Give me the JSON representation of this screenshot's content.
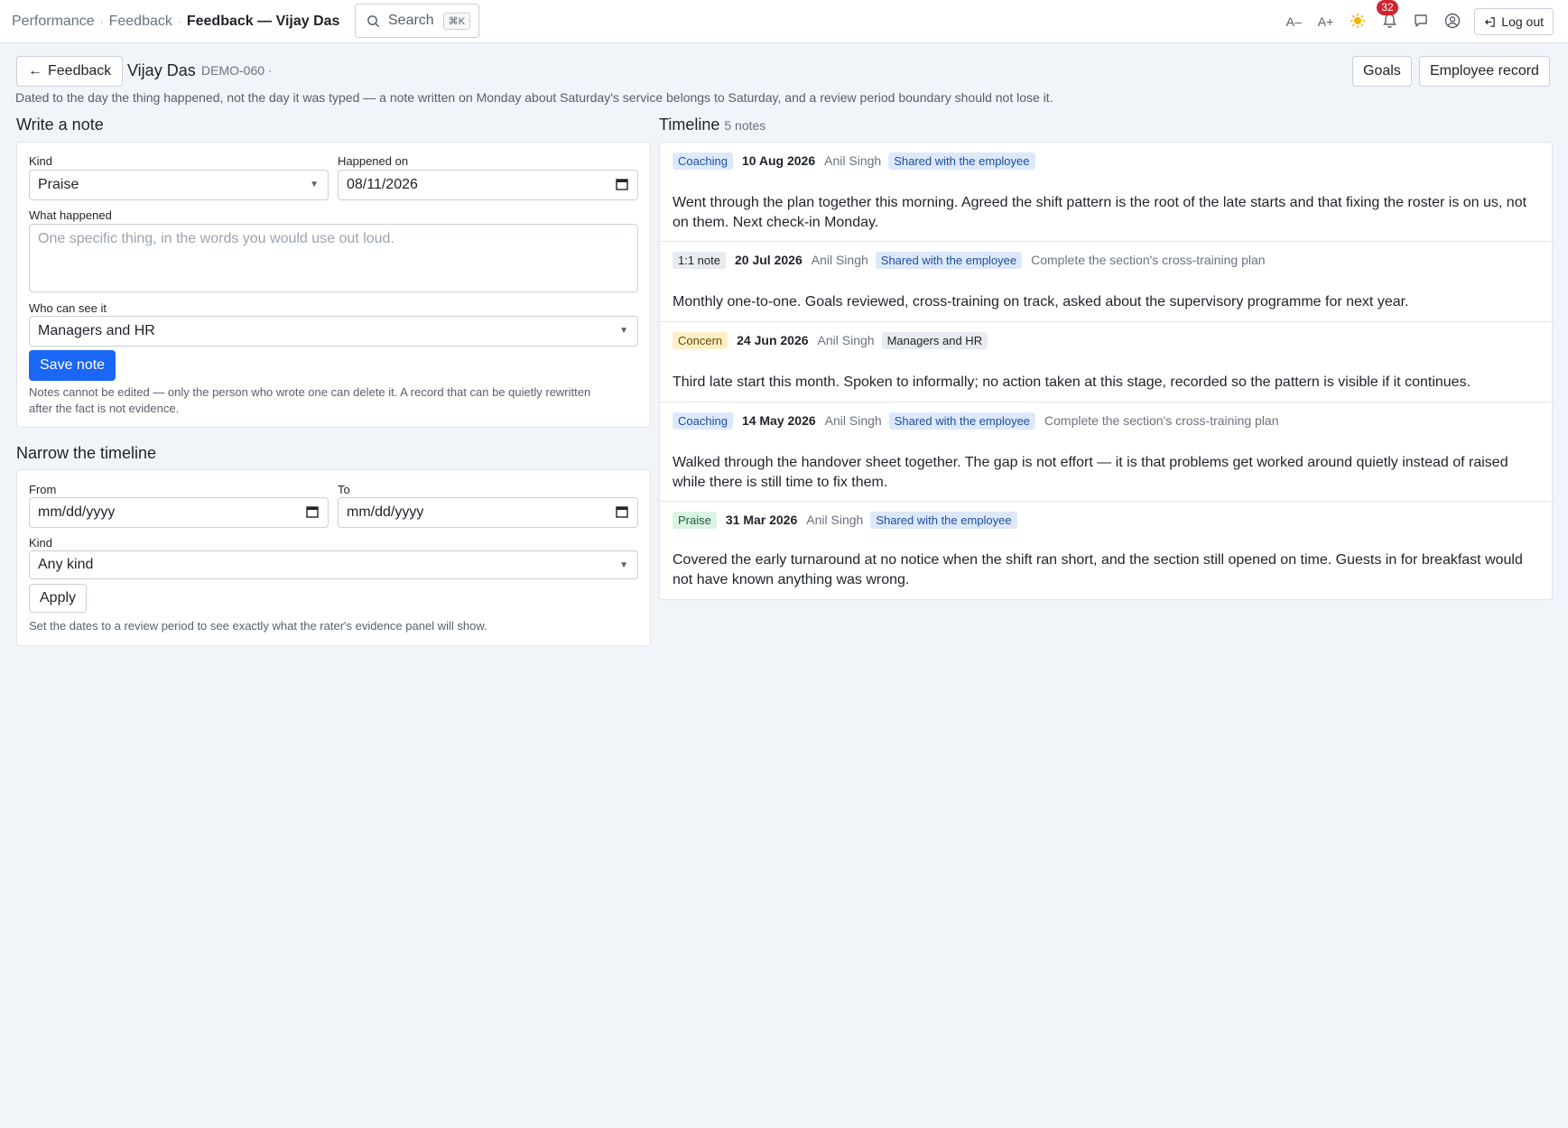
{
  "breadcrumb": [
    "Performance",
    "Feedback",
    "Feedback — Vijay Das"
  ],
  "search": {
    "label": "Search",
    "shortcut": "⌘K"
  },
  "topbar": {
    "font_smaller": "A–",
    "font_larger": "A+",
    "notifications_count": "32",
    "logout_label": "Log out"
  },
  "header": {
    "back_label": "Feedback",
    "employee_name": "Vijay Das",
    "employee_code": "DEMO-060 ·",
    "goals_label": "Goals",
    "record_label": "Employee record",
    "intro": "Dated to the day the thing happened, not the day it was typed — a note written on Monday about Saturday's service belongs to Saturday, and a review period boundary should not lose it."
  },
  "write": {
    "title": "Write a note",
    "kind_label": "Kind",
    "kind_value": "Praise",
    "date_label": "Happened on",
    "date_value": "08/11/2026",
    "what_label": "What happened",
    "what_placeholder": "One specific thing, in the words you would use out loud.",
    "who_label": "Who can see it",
    "who_value": "Managers and HR",
    "save_label": "Save note",
    "help": "Notes cannot be edited — only the person who wrote one can delete it. A record that can be quietly rewritten after the fact is not evidence."
  },
  "narrow": {
    "title": "Narrow the timeline",
    "from_label": "From",
    "from_value": "mm/dd/yyyy",
    "to_label": "To",
    "to_value": "mm/dd/yyyy",
    "kind_label": "Kind",
    "kind_value": "Any kind",
    "apply_label": "Apply",
    "help": "Set the dates to a review period to see exactly what the rater's evidence panel will show."
  },
  "timeline": {
    "title": "Timeline",
    "count": "5 notes",
    "items": [
      {
        "kind": "Coaching",
        "date": "10 Aug 2026",
        "author": "Anil Singh",
        "visibility": "Shared with the employee",
        "goal": "",
        "body": "Went through the plan together this morning. Agreed the shift pattern is the root of the late starts and that fixing the roster is on us, not on them. Next check-in Monday."
      },
      {
        "kind": "1:1 note",
        "date": "20 Jul 2026",
        "author": "Anil Singh",
        "visibility": "Shared with the employee",
        "goal": "Complete the section's cross-training plan",
        "body": "Monthly one-to-one. Goals reviewed, cross-training on track, asked about the supervisory programme for next year."
      },
      {
        "kind": "Concern",
        "date": "24 Jun 2026",
        "author": "Anil Singh",
        "visibility": "Managers and HR",
        "goal": "",
        "body": "Third late start this month. Spoken to informally; no action taken at this stage, recorded so the pattern is visible if it continues."
      },
      {
        "kind": "Coaching",
        "date": "14 May 2026",
        "author": "Anil Singh",
        "visibility": "Shared with the employee",
        "goal": "Complete the section's cross-training plan",
        "body": "Walked through the handover sheet together. The gap is not effort — it is that problems get worked around quietly instead of raised while there is still time to fix them."
      },
      {
        "kind": "Praise",
        "date": "31 Mar 2026",
        "author": "Anil Singh",
        "visibility": "Shared with the employee",
        "goal": "",
        "body": "Covered the early turnaround at no notice when the shift ran short, and the section still opened on time. Guests in for breakfast would not have known anything was wrong."
      }
    ]
  }
}
